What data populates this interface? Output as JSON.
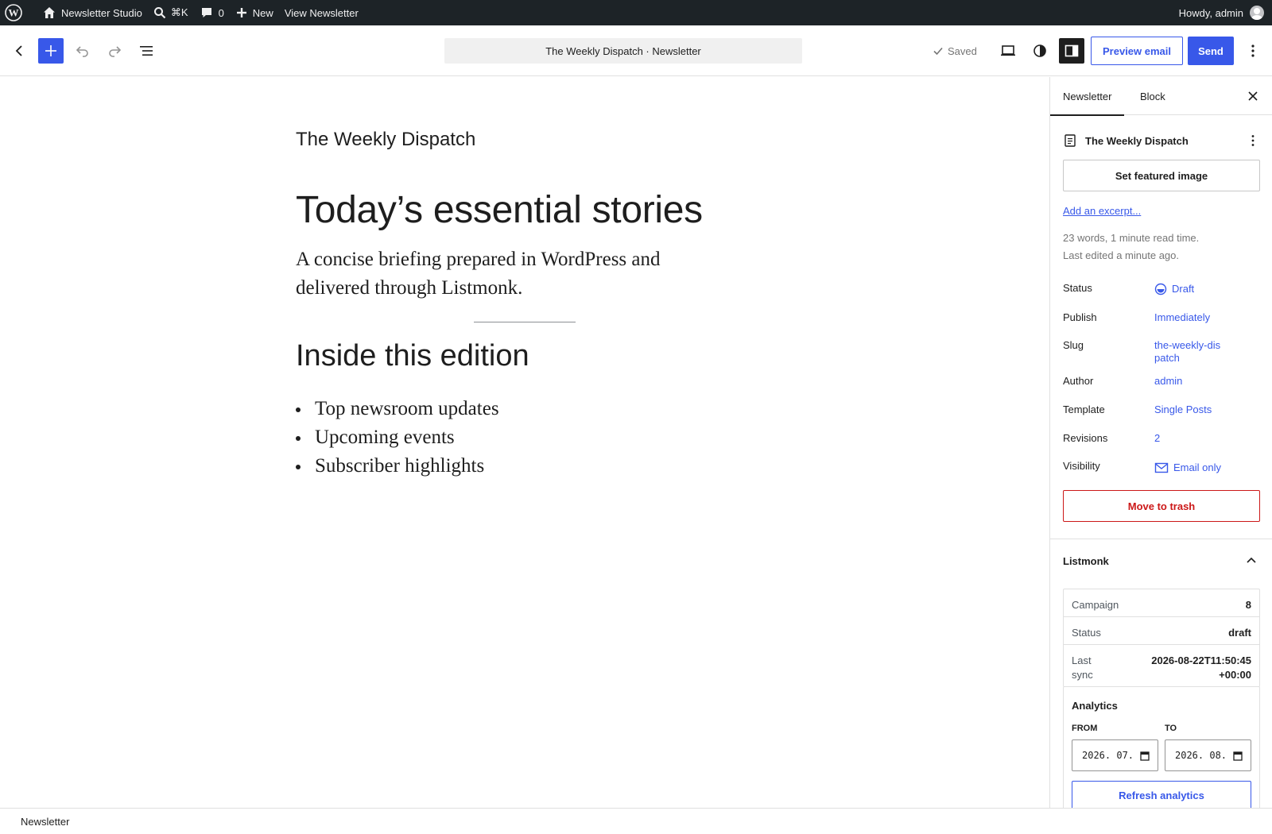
{
  "adminbar": {
    "site_name": "Newsletter Studio",
    "search_shortcut": "⌘K",
    "comments_count": "0",
    "new_label": "New",
    "view_label": "View Newsletter",
    "howdy": "Howdy, admin"
  },
  "header": {
    "document_title": "The Weekly Dispatch · Newsletter",
    "saved_label": "Saved",
    "preview_label": "Preview email",
    "send_label": "Send"
  },
  "canvas": {
    "newsletter_title": "The Weekly Dispatch",
    "heading": "Today’s essential stories",
    "lead": "A concise briefing prepared in WordPress and delivered through Listmonk.",
    "subheading": "Inside this edition",
    "list_items": [
      "Top newsroom updates",
      "Upcoming events",
      "Subscriber highlights"
    ]
  },
  "sidebar": {
    "tabs": [
      "Newsletter",
      "Block"
    ],
    "post_title": "The Weekly Dispatch",
    "featured_image_label": "Set featured image",
    "excerpt_label": "Add an excerpt...",
    "words_meta": "23 words, 1 minute read time.",
    "edited_meta": "Last edited a minute ago.",
    "rows": {
      "status": {
        "label": "Status",
        "value": "Draft"
      },
      "publish": {
        "label": "Publish",
        "value": "Immediately"
      },
      "slug": {
        "label": "Slug",
        "value": "the-weekly-dispatch"
      },
      "author": {
        "label": "Author",
        "value": "admin"
      },
      "template": {
        "label": "Template",
        "value": "Single Posts"
      },
      "revisions": {
        "label": "Revisions",
        "value": "2"
      },
      "visibility": {
        "label": "Visibility",
        "value": "Email only"
      }
    },
    "trash_label": "Move to trash",
    "listmonk": {
      "title": "Listmonk",
      "campaign": {
        "label": "Campaign",
        "value": "8"
      },
      "status": {
        "label": "Status",
        "value": "draft"
      },
      "last_sync": {
        "label": "Last sync",
        "value": "2026-08-22T11:50:45+00:00"
      }
    },
    "analytics": {
      "title": "Analytics",
      "from_label": "FROM",
      "to_label": "TO",
      "from_value": "2026. 07.",
      "to_value": "2026. 08.",
      "refresh_label": "Refresh analytics"
    }
  },
  "footer": {
    "breadcrumb": "Newsletter"
  },
  "colors": {
    "accent": "#3858e9",
    "danger": "#cc1818",
    "adminbar": "#1d2327"
  }
}
